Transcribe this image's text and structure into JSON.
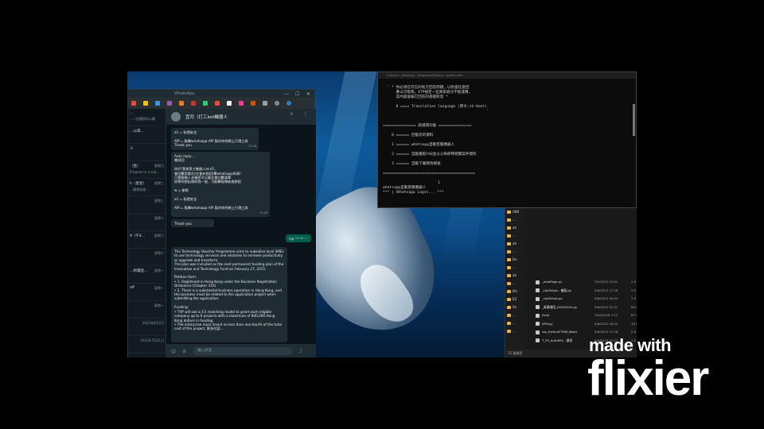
{
  "whatsapp": {
    "window_title": "WhatsApp",
    "window_controls": [
      "—",
      "☐",
      "✕"
    ],
    "chat_name": "宜司（打工bot機器人",
    "sidebar_items": [
      {
        "name": "…",
        "preview": "…一份國家的公職",
        "time": ""
      },
      {
        "name": "…公眾…",
        "preview": "",
        "time": ""
      },
      {
        "name": "人",
        "preview": "",
        "time": ""
      },
      {
        "name": "（坐）",
        "preview": "Program is a sub...",
        "time": "星期日"
      },
      {
        "name": "h（星星）",
        "preview": "…讓我很遠…",
        "time": "星期三"
      },
      {
        "name": "",
        "preview": "",
        "time": "星期三"
      },
      {
        "name": "",
        "preview": "",
        "time": "星期二"
      },
      {
        "name": "9（午4…",
        "preview": "",
        "time": "星期二"
      },
      {
        "name": "",
        "preview": "",
        "time": "星期二"
      },
      {
        "name": "…熱電話…",
        "preview": "",
        "time": "星期一"
      },
      {
        "name": "eff",
        "preview": "",
        "time": "星期一"
      },
      {
        "name": "",
        "preview": "",
        "time": "星期一"
      },
      {
        "name": "",
        "preview": "",
        "time": "2022年8月2日"
      },
      {
        "name": "",
        "preview": "",
        "time": "2022年7月21日"
      }
    ],
    "messages": [
      {
        "text": "a1 = 私隱安全\n\nAPI = 點擊whatsapp API 製作你的網上引現工具\nThank you",
        "time": "23:08"
      },
      {
        "text": "Auto reply …\n嘗試回\n\n你好!我係第三機器人ain仔。\n會回覆您要在(在會有個)回覆whatsapp的清!\n只需要輸入名稱即可以看在會回覆清單\n如果你想出現如我一般，可點擊搜尋檢查群組\n\nw = 刪除\n\na1 = 私隱安全\n\nAPI = 點擊whatsapp API 製作你的網上引現工具",
        "time": "23:08"
      },
      {
        "text": "Thank you",
        "time": "23:08"
      }
    ],
    "outgoing": {
      "text": "hip",
      "time": "23:08 ✓✓"
    },
    "long_message": "The Technology Voucher Programme aims to subsidize local SMEs to use technology services and solutions to increase productivity or upgrade and transform.\nThe plan was included as the next permanent funding plan of the Innovation and Technology Fund on February 27, 2015.\n\nPetition form:\n• 1. Registered in Hong Kong under the Business Registration Ordinance (Chapter 310)\n• 2. There is a substantial business operation in Hong Kong, and the business must be related to the application project when submitting the application.\n\nFunding:\n• TVP will use a 3:1 matching model to grant each eligible company up to 6 projects with a maximum of 600,000 Hong Kong dollars in funding.\n• The enterprise must invest no less than one-fourth of the total cost of the project, 更多內容…",
    "input_placeholder": "輸入訊息"
  },
  "terminal": {
    "title": "C:\\Users\\…\\Desktop\\…\\Programs\\Python\\…\\python.exe",
    "lines": [
      "",
      "  ' * 你必須在可信的地方回答問題，以防當任意回",
      "      應以可能我，ATP規定一些異系統冷不能運算，",
      "      其內容會編它回答的基礎訊息 *",
      "",
      "      0 ==== Translation language (原文:zh-Hant)",
      "                                               '",
      "",
      "",
      "=============== 請選擇功能 ===============",
      "",
      "    0 ====== 回復您的資料",
      "",
      "    1 ====== whatsapp自動客服機器人",
      "",
      "    2 ====== 自動獲取FAQ並以公佈即時相關案件資料",
      "",
      "    3 ====== 自動下載網頁模板",
      "",
      "==========================================",
      "",
      "                         1",
      "whatsapp自動客服機器人",
      "*** | Ｗhatsapp Login... ***"
    ]
  },
  "explorer": {
    "tree": [
      "",
      "",
      "",
      "",
      "",
      "",
      "",
      "",
      "",
      "",
      "ABB",
      "…",
      "ab",
      "…",
      "ab",
      "…",
      "De",
      "…",
      "ab",
      "…",
      "Ma",
      "ES",
      "Se",
      "…",
      "…",
      "…"
    ],
    "files": [
      {
        "name": "_InitePage.py",
        "date": "7/2/2022 23:01",
        "size": "2 K"
      },
      {
        "name": "_UpGithub - 複製.py",
        "date": "9/6/2023 17:18",
        "size": "5 K"
      },
      {
        "name": "_UpGithub.py",
        "date": "9/6/2023 16:44",
        "size": "3 K"
      },
      {
        "name": "_資產階段_04202022.py",
        "date": "9/6/2023 23:31",
        "size": "62 K"
      },
      {
        "name": "Exist",
        "date": "15/5/2018 7:12",
        "size": "87 K"
      },
      {
        "name": "KTM.py",
        "date": "9/6/2022 16:43",
        "size": "19 K"
      },
      {
        "name": "zzz_PythonFTMM_Need",
        "date": "9/6/2023 17:18",
        "size": "5 K"
      },
      {
        "name": "T_PV_auth005 - 捷徑",
        "date": "9/6/2023 22:27",
        "size": "1 K"
      }
    ],
    "status": "15 個項目"
  },
  "watermark": {
    "small": "made with",
    "big": "flixier"
  }
}
